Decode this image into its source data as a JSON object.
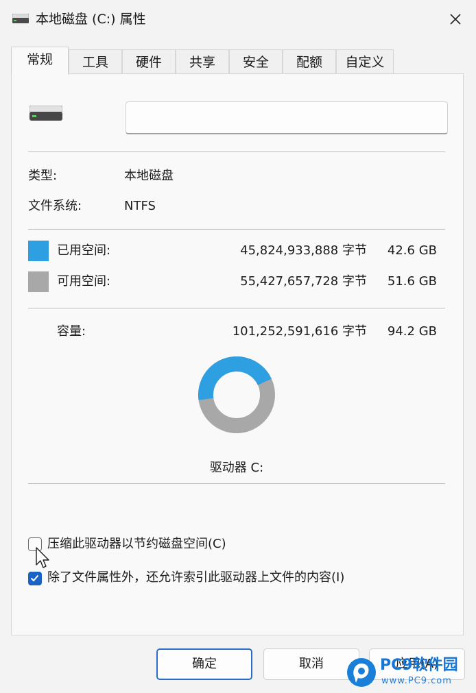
{
  "window": {
    "title": "本地磁盘 (C:) 属性",
    "title_icon": "drive-icon",
    "close_icon": "close-icon"
  },
  "tabs": [
    {
      "label": "常规",
      "active": true
    },
    {
      "label": "工具",
      "active": false
    },
    {
      "label": "硬件",
      "active": false
    },
    {
      "label": "共享",
      "active": false
    },
    {
      "label": "安全",
      "active": false
    },
    {
      "label": "配额",
      "active": false
    },
    {
      "label": "自定义",
      "active": false
    }
  ],
  "general": {
    "drive_name_value": "",
    "type_label": "类型:",
    "type_value": "本地磁盘",
    "fs_label": "文件系统:",
    "fs_value": "NTFS",
    "used_label": "已用空间:",
    "used_bytes": "45,824,933,888 字节",
    "used_size": "42.6 GB",
    "free_label": "可用空间:",
    "free_bytes": "55,427,657,728 字节",
    "free_size": "51.6 GB",
    "capacity_label": "容量:",
    "capacity_bytes": "101,252,591,616 字节",
    "capacity_size": "94.2 GB",
    "drive_label": "驱动器 C:",
    "used_fraction": 0.4526,
    "compress_label": "压缩此驱动器以节约磁盘空间(C)",
    "compress_checked": false,
    "index_label": "除了文件属性外，还允许索引此驱动器上文件的内容(I)",
    "index_checked": true
  },
  "colors": {
    "used": "#2e9fe0",
    "free": "#a8a8a8",
    "accent": "#1a63c4"
  },
  "buttons": {
    "ok": "确定",
    "cancel": "取消",
    "apply": "应用(A)"
  },
  "watermark": {
    "title": "PC9软件园",
    "url": "www.PC9.com"
  }
}
